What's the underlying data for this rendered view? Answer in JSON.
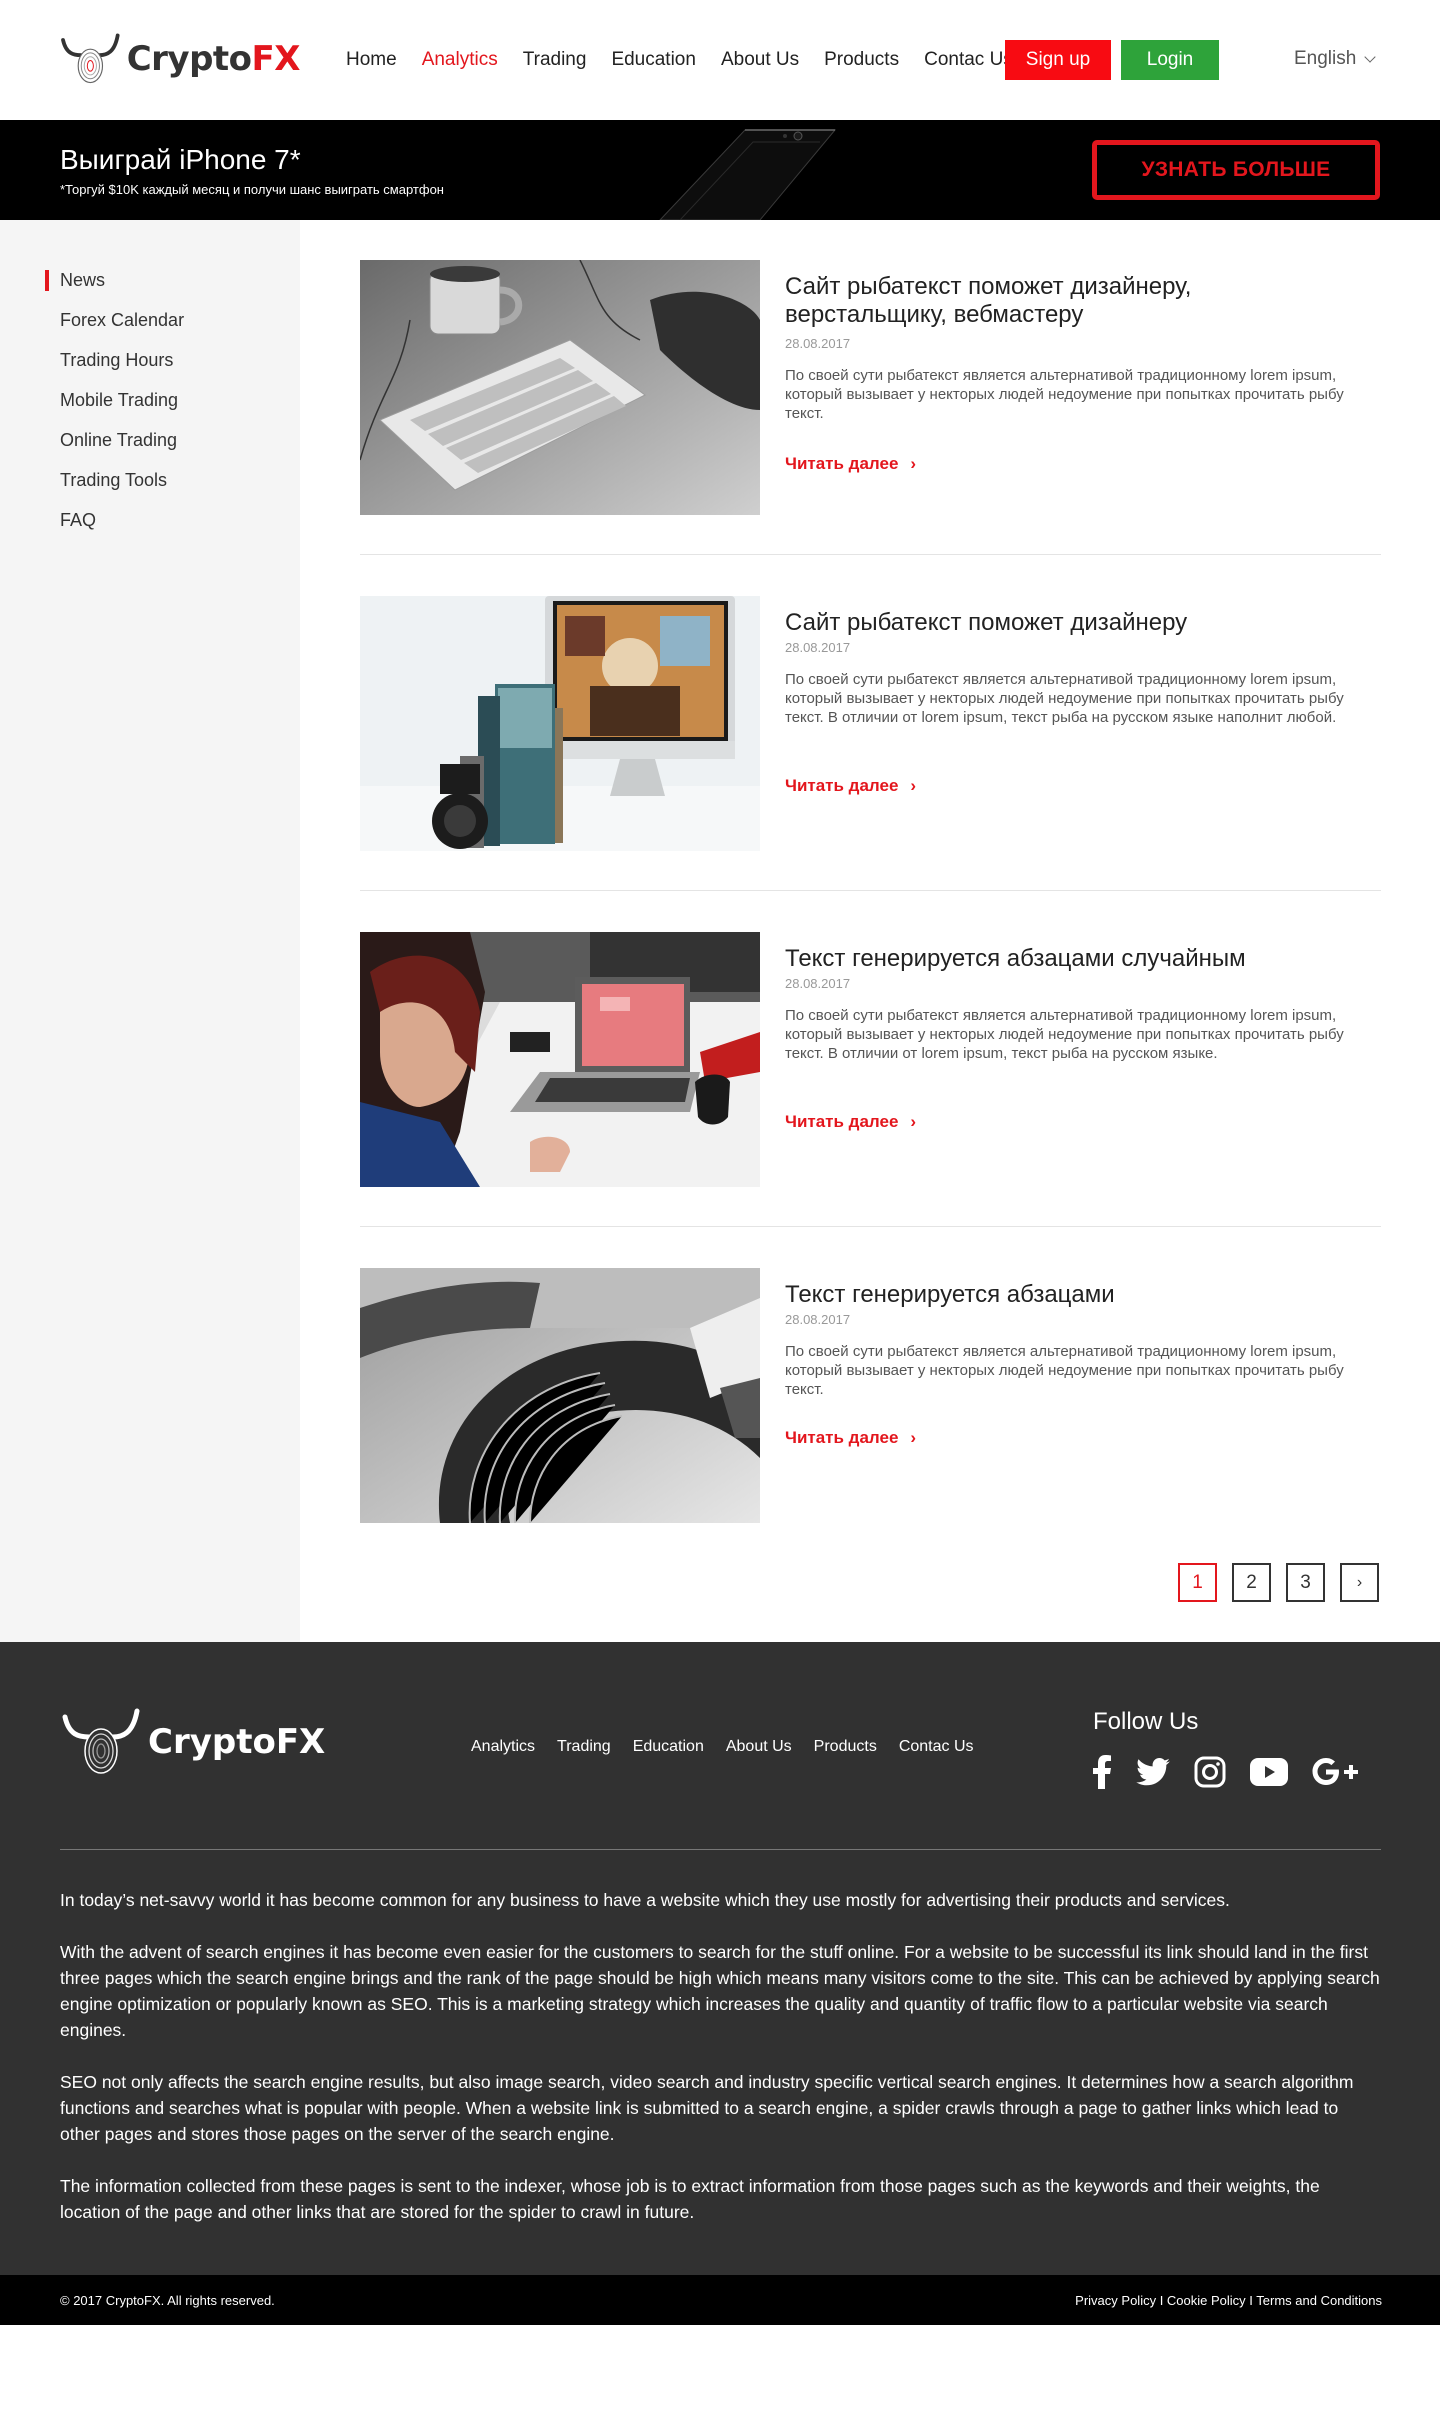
{
  "brand": {
    "name_part1": "Crypto",
    "name_part2": "FX",
    "footer_name": "CryptoFX"
  },
  "nav": {
    "items": [
      "Home",
      "Analytics",
      "Trading",
      "Education",
      "About Us",
      "Products",
      "Contac Us"
    ],
    "active": "Analytics",
    "signup_label": "Sign up",
    "login_label": "Login",
    "language": "English"
  },
  "promo": {
    "title": "Выиграй iPhone 7*",
    "subtitle": "*Торгуй $10K каждый месяц и получи шанс выиграть смартфон",
    "button_label": "УЗНАТЬ БОЛЬШЕ"
  },
  "sidebar": {
    "items": [
      "News",
      "Forex Calendar",
      "Trading Hours",
      "Mobile Trading",
      "Online Trading",
      "Trading Tools",
      "FAQ"
    ],
    "active": "News"
  },
  "articles": [
    {
      "title": "Сайт рыбатекст поможет дизайнеру, верстальщику, вебмастеру",
      "date": "28.08.2017",
      "excerpt": "По своей сути рыбатекст является альтернативой традиционному lorem ipsum, который вызывает у некторых людей недоумение при попытках прочитать рыбу текст.",
      "more_label": "Читать далее",
      "image": "keyboard-photo"
    },
    {
      "title": "Сайт рыбатекст поможет дизайнеру",
      "date": "28.08.2017",
      "excerpt": "По своей сути рыбатекст является альтернативой традиционному lorem ipsum, который вызывает у некторых людей недоумение при попытках прочитать рыбу текст. В отличии от lorem ipsum, текст рыба на русском языке наполнит любой.",
      "more_label": "Читать далее",
      "image": "imac-photo"
    },
    {
      "title": "Текст генерируется абзацами случайным",
      "date": "28.08.2017",
      "excerpt": "По своей сути рыбатекст является альтернативой традиционному lorem ipsum, который вызывает у некторых людей недоумение при попытках прочитать рыбу текст. В отличии от lorem ipsum, текст рыба на русском языке.",
      "more_label": "Читать далее",
      "image": "laptop-meeting-photo"
    },
    {
      "title": "Текст генерируется абзацами",
      "date": "28.08.2017",
      "excerpt": "По своей сути рыбатекст является альтернативой традиционному lorem ipsum, который вызывает у некторых людей недоумение при попытках прочитать рыбу текст.",
      "more_label": "Читать далее",
      "image": "typewriter-photo"
    }
  ],
  "pagination": {
    "pages": [
      "1",
      "2",
      "3"
    ],
    "current": "1",
    "next_icon": "chevron-right-icon",
    "next_glyph": "›"
  },
  "footer": {
    "nav": [
      "Analytics",
      "Trading",
      "Education",
      "About Us",
      "Products",
      "Contac Us"
    ],
    "follow_label": "Follow Us",
    "socials": [
      "facebook-icon",
      "twitter-icon",
      "instagram-icon",
      "youtube-icon",
      "google-plus-icon"
    ],
    "paragraphs": [
      "In today’s net-savvy world it has become common for any business to have a website which they use mostly for advertising their products and services.",
      "With the advent of search engines it has become even easier for the customers to search for the stuff online. For a website to be successful its link should land in the first three pages which the search engine brings and the rank of the page should be high which means many visitors come to the site. This can be achieved by applying search engine optimization or popularly known as SEO. This is a marketing strategy which increases the quality and quantity of traffic flow to a particular website via search engines.",
      "SEO not only affects the search engine results, but also image search, video search and industry specific vertical search engines. It determines how a search algorithm functions and searches what is popular with people. When a website link is submitted to a search engine, a spider crawls through a page to gather links which lead to other pages and stores those pages on the server of the search engine.",
      "The information collected from these pages is sent to the indexer, whose job is to extract information from those pages such as the keywords and their weights, the location of the page and other links that are stored for the spider to crawl in future."
    ],
    "copyright": "© 2017 CryptoFX. All rights reserved.",
    "legal": "Privacy Policy I Cookie Policy I Terms and Conditions"
  },
  "colors": {
    "accent": "#e3161d",
    "signup": "#f80b12",
    "login": "#2ea33a",
    "footer_bg": "#313131"
  }
}
